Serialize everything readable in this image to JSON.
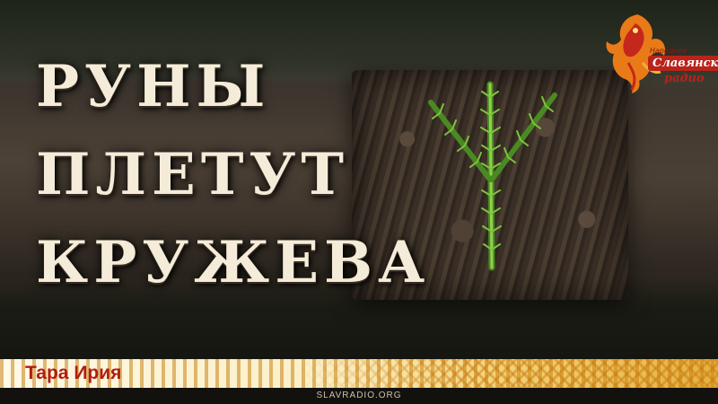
{
  "title": {
    "line1": "Руны",
    "line2": "плетут",
    "line3": "кружева"
  },
  "logo": {
    "small": "Народное",
    "name": "Славянское",
    "radio": "радио"
  },
  "banner": {
    "author": "Тара Ирия"
  },
  "footer": {
    "site": "SLAVRADIO.ORG"
  },
  "colors": {
    "title_text": "#f4ecd8",
    "banner_text": "#b11d12",
    "logo_red": "#b8231a",
    "banner_gold": "#e4b040"
  },
  "icons": {
    "logo": "firebird-icon",
    "rune": "fern-rune-image"
  }
}
